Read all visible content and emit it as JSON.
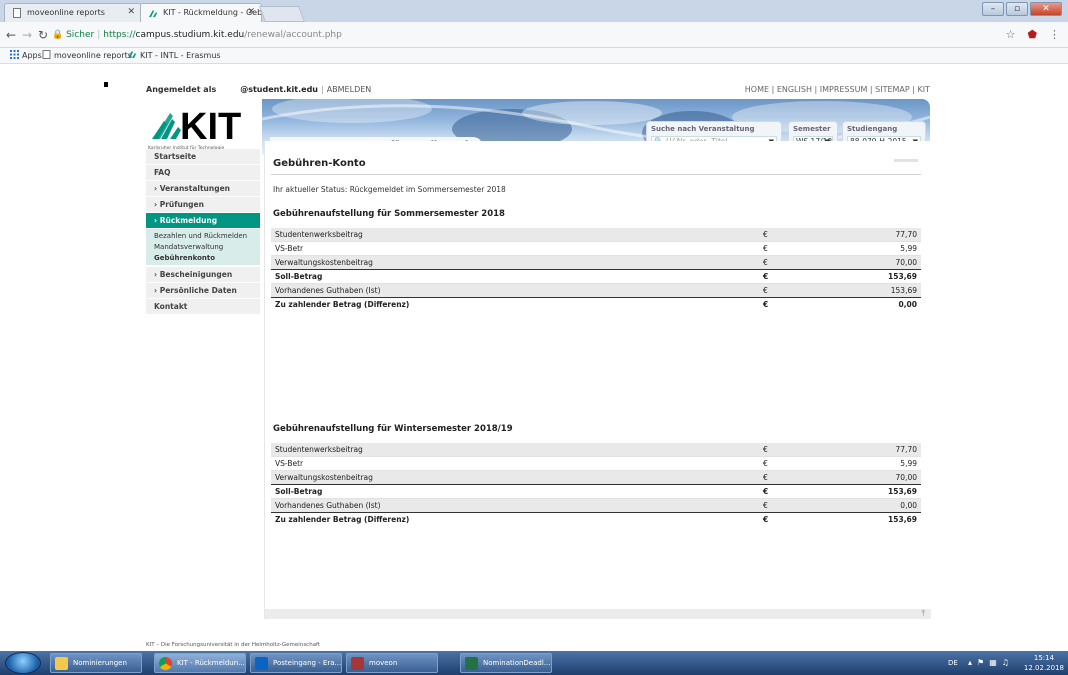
{
  "browser": {
    "tabs": [
      {
        "title": "moveonline reports"
      },
      {
        "title": "KIT - Rückmeldung - Geb"
      }
    ],
    "secure_label": "Sicher",
    "url_scheme": "https://",
    "url_host": "campus.studium.kit.edu",
    "url_path": "/renewal/account.php",
    "bookmarks": [
      "Apps",
      "moveonline reports",
      "KIT - INTL - Erasmus"
    ]
  },
  "site": {
    "logged_in_label": "Angemeldet als",
    "user": "@student.kit.edu",
    "logout_label": "ABMELDEN",
    "meta_links": "HOME | ENGLISH | IMPRESSUM | SITEMAP | KIT",
    "logo_text": "KIT",
    "logo_tagline": "Karlsruher Institut für Technologie",
    "app_title": "Campus Management für Studierende",
    "search": {
      "label": "Suche nach Veranstaltung",
      "placeholder": "LV-Nr. oder -Titel"
    },
    "semester": {
      "label": "Semester",
      "value": "WS 17/18"
    },
    "program": {
      "label": "Studiengang",
      "value": "88-079-H-2015"
    },
    "footer": "KIT – Die Forschungsuniversität in der Helmholtz-Gemeinschaft"
  },
  "sidebar": {
    "items": [
      {
        "label": "Startseite"
      },
      {
        "label": "FAQ"
      },
      {
        "label": "› Veranstaltungen"
      },
      {
        "label": "› Prüfungen"
      },
      {
        "label": "› Rückmeldung"
      },
      {
        "label": "› Bescheinigungen"
      },
      {
        "label": "› Persönliche Daten"
      },
      {
        "label": "Kontakt"
      }
    ],
    "subitems": [
      {
        "label": "Bezahlen und Rückmelden"
      },
      {
        "label": "Mandatsverwaltung"
      },
      {
        "label": "Gebührenkonto"
      }
    ]
  },
  "content": {
    "title": "Gebühren-Konto",
    "status": "Ihr aktueller Status: Rückgemeldet im Sommersemester 2018",
    "currency": "€",
    "sections": [
      {
        "title": "Gebührenaufstellung für Sommersemester 2018",
        "rows": [
          {
            "label": "Studentenwerksbeitrag",
            "amount": "77,70"
          },
          {
            "label": "VS-Betr",
            "amount": "5,99"
          },
          {
            "label": "Verwaltungskostenbeitrag",
            "amount": "70,00"
          },
          {
            "label": "Soll-Betrag",
            "amount": "153,69"
          },
          {
            "label": "Vorhandenes Guthaben (Ist)",
            "amount": "153,69"
          },
          {
            "label": "Zu zahlender Betrag (Differenz)",
            "amount": "0,00"
          }
        ]
      },
      {
        "title": "Gebührenaufstellung für Wintersemester 2018/19",
        "rows": [
          {
            "label": "Studentenwerksbeitrag",
            "amount": "77,70"
          },
          {
            "label": "VS-Betr",
            "amount": "5,99"
          },
          {
            "label": "Verwaltungskostenbeitrag",
            "amount": "70,00"
          },
          {
            "label": "Soll-Betrag",
            "amount": "153,69"
          },
          {
            "label": "Vorhandenes Guthaben (Ist)",
            "amount": "0,00"
          },
          {
            "label": "Zu zahlender Betrag (Differenz)",
            "amount": "153,69"
          }
        ]
      }
    ]
  },
  "taskbar": {
    "items": [
      {
        "label": "Nominierungen",
        "icon": "folder-icon"
      },
      {
        "label": "KIT - Rückmeldun...",
        "icon": "chrome-icon"
      },
      {
        "label": "Posteingang - Era...",
        "icon": "outlook-icon"
      },
      {
        "label": "moveon",
        "icon": "access-icon"
      },
      {
        "label": "NominationDeadl...",
        "icon": "excel-icon"
      }
    ],
    "language": "DE",
    "time": "15:14",
    "date": "12.02.2018"
  },
  "colors": {
    "kit_green": "#009682",
    "header_blue": "#6b96c6",
    "taskbar": "#2a4f85"
  }
}
